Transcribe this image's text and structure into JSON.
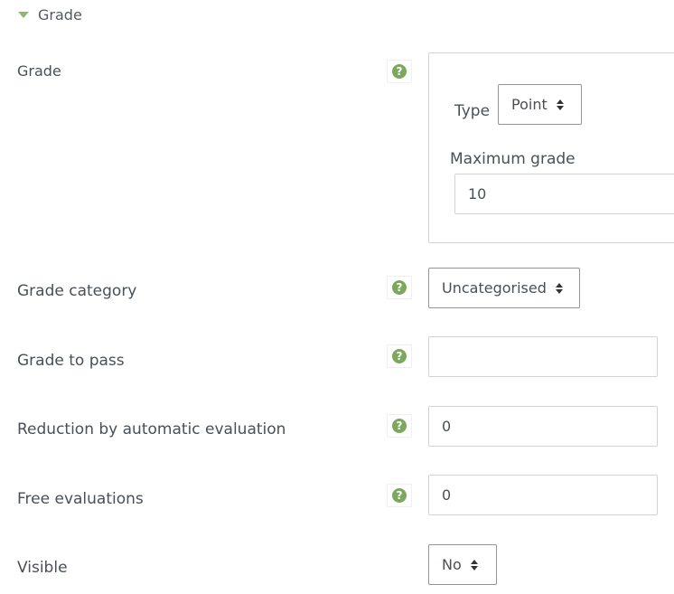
{
  "section": {
    "title": "Grade"
  },
  "rows": {
    "grade": {
      "label": "Grade"
    },
    "grade_category": {
      "label": "Grade category",
      "value": "Uncategorised"
    },
    "grade_to_pass": {
      "label": "Grade to pass",
      "value": ""
    },
    "reduction": {
      "label": "Reduction by automatic evaluation",
      "value": "0"
    },
    "free_evaluations": {
      "label": "Free evaluations",
      "value": "0"
    },
    "visible": {
      "label": "Visible",
      "value": "No"
    }
  },
  "grade_group": {
    "type_label": "Type",
    "type_value": "Point",
    "max_grade_label": "Maximum grade",
    "max_grade_value": "10"
  },
  "icons": {
    "help": "?"
  },
  "colors": {
    "help_icon": "#7ba85c",
    "caret": "#8fb873"
  }
}
